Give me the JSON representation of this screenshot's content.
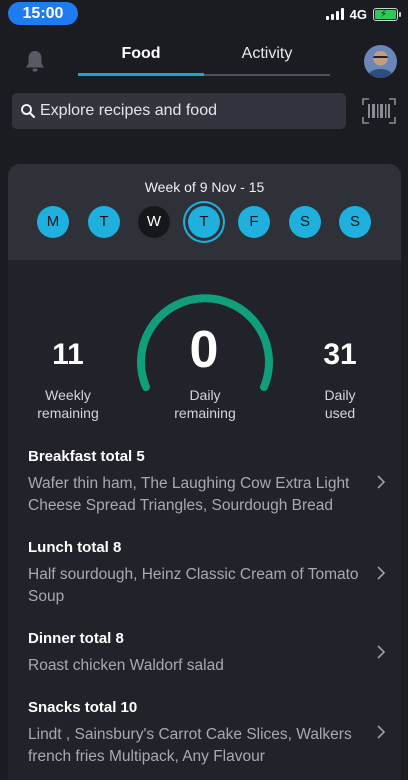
{
  "status_bar": {
    "time": "15:00",
    "network": "4G"
  },
  "header": {
    "tabs": [
      {
        "label": "Food",
        "active": true
      },
      {
        "label": "Activity",
        "active": false
      }
    ]
  },
  "search": {
    "placeholder": "Explore recipes and food"
  },
  "week": {
    "title": "Week of 9 Nov - 15",
    "days": [
      {
        "letter": "M",
        "state": "filled"
      },
      {
        "letter": "T",
        "state": "filled"
      },
      {
        "letter": "W",
        "state": "dark"
      },
      {
        "letter": "T",
        "state": "selected"
      },
      {
        "letter": "F",
        "state": "filled"
      },
      {
        "letter": "S",
        "state": "filled"
      },
      {
        "letter": "S",
        "state": "filled"
      }
    ]
  },
  "points": {
    "weekly_remaining": "11",
    "weekly_remaining_label_1": "Weekly",
    "weekly_remaining_label_2": "remaining",
    "daily_remaining": "0",
    "daily_remaining_label_1": "Daily",
    "daily_remaining_label_2": "remaining",
    "daily_used": "31",
    "daily_used_label_1": "Daily",
    "daily_used_label_2": "used"
  },
  "meals": [
    {
      "title": "Breakfast total  5",
      "items": "Wafer thin ham, The Laughing Cow Extra Light Cheese Spread Triangles, Sourdough Bread"
    },
    {
      "title": "Lunch total  8",
      "items": "Half sourdough, Heinz Classic Cream of Tomato Soup"
    },
    {
      "title": "Dinner total  8",
      "items": "Roast chicken Waldorf salad"
    },
    {
      "title": "Snacks total  10",
      "items": "Lindt , Sainsbury's Carrot Cake Slices, Walkers french fries Multipack, Any Flavour"
    }
  ],
  "colors": {
    "accent": "#1fb0dd",
    "gauge": "#0f9f7a",
    "background": "#1b1c22",
    "time_pill": "#1e7cf0"
  }
}
